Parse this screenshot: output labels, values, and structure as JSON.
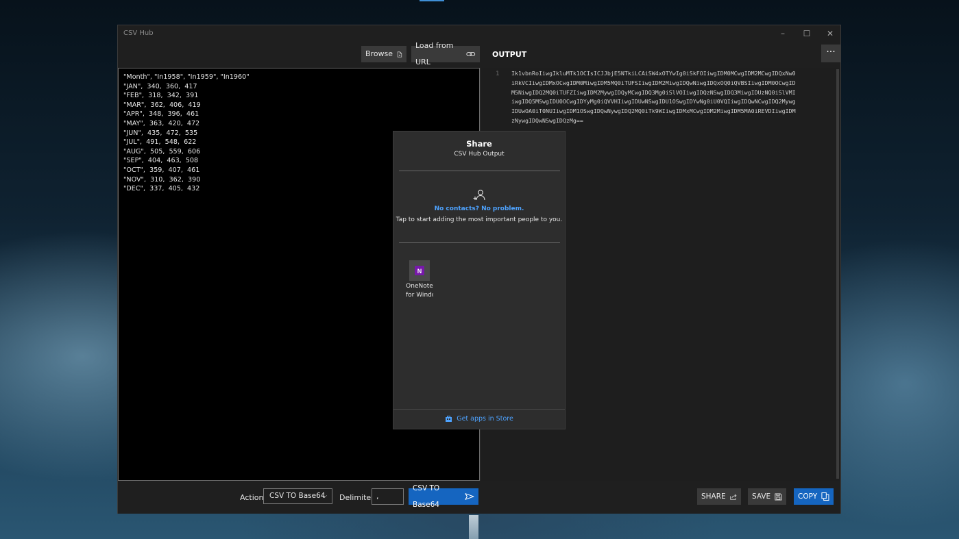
{
  "app": {
    "title": "CSV Hub"
  },
  "window_controls": {
    "minimize": "–",
    "maximize": "☐",
    "close": "✕"
  },
  "toolbar": {
    "browse_label": "Browse",
    "load_url_label": "Load from URL",
    "output_label": "OUTPUT",
    "more_label": "···"
  },
  "input": {
    "lines": [
      "\"Month\", \"In1958\", \"In1959\", \"In1960\"",
      "\"JAN\",  340,  360,  417",
      "\"FEB\",  318,  342,  391",
      "\"MAR\",  362,  406,  419",
      "\"APR\",  348,  396,  461",
      "\"MAY\",  363,  420,  472",
      "\"JUN\",  435,  472,  535",
      "\"JUL\",  491,  548,  622",
      "\"AUG\",  505,  559,  606",
      "\"SEP\",  404,  463,  508",
      "\"OCT\",  359,  407,  461",
      "\"NOV\",  310,  362,  390",
      "\"DEC\",  337,  405,  432"
    ]
  },
  "output": {
    "line_number": "1",
    "lines": [
      "Ik1vbnRoIiwgIkluMTk1OCIsICJJbjE5NTkiLCAiSW4xOTYwIg0iSkFOIiwgIDM0MCwgIDM2MCwgIDQxNw0",
      "iRkVCIiwgIDMxOCwgIDM0MiwgIDM5MQ0iTUFSIiwgIDM2MiwgIDQwNiwgIDQxOQ0iQVBSIiwgIDM0OCwgID",
      "M5NiwgIDQ2MQ0iTUFZIiwgIDM2MywgIDQyMCwgIDQ3Mg0iSlVOIiwgIDQzNSwgIDQ3MiwgIDUzNQ0iSlVMI",
      "iwgIDQ5MSwgIDU0OCwgIDYyMg0iQVVHIiwgIDUwNSwgIDU1OSwgIDYwNg0iU0VQIiwgIDQwNCwgIDQ2Mywg",
      "IDUwOA0iT0NUIiwgIDM1OSwgIDQwNywgIDQ2MQ0iTk9WIiwgIDMxMCwgIDM2MiwgIDM5MA0iREVDIiwgIDM",
      "zNywgIDQwNSwgIDQzMg=="
    ]
  },
  "bottom": {
    "action_label": "Action",
    "action_value": "CSV TO Base64",
    "delimiter_label": "Delimiter",
    "delimiter_value": ",",
    "run_label": "CSV TO Base64",
    "share_label": "SHARE",
    "save_label": "SAVE",
    "copy_label": "COPY"
  },
  "share_panel": {
    "title": "Share",
    "subtitle": "CSV Hub Output",
    "no_contacts": "No contacts? No problem.",
    "tap_text": "Tap to start adding the most important people to you.",
    "app_name_line1": "OneNote",
    "app_name_line2": "for Windo",
    "store_link": "Get apps in Store"
  },
  "colors": {
    "accent": "#1565c0",
    "link": "#4ea3ff",
    "onenote": "#7719aa"
  }
}
